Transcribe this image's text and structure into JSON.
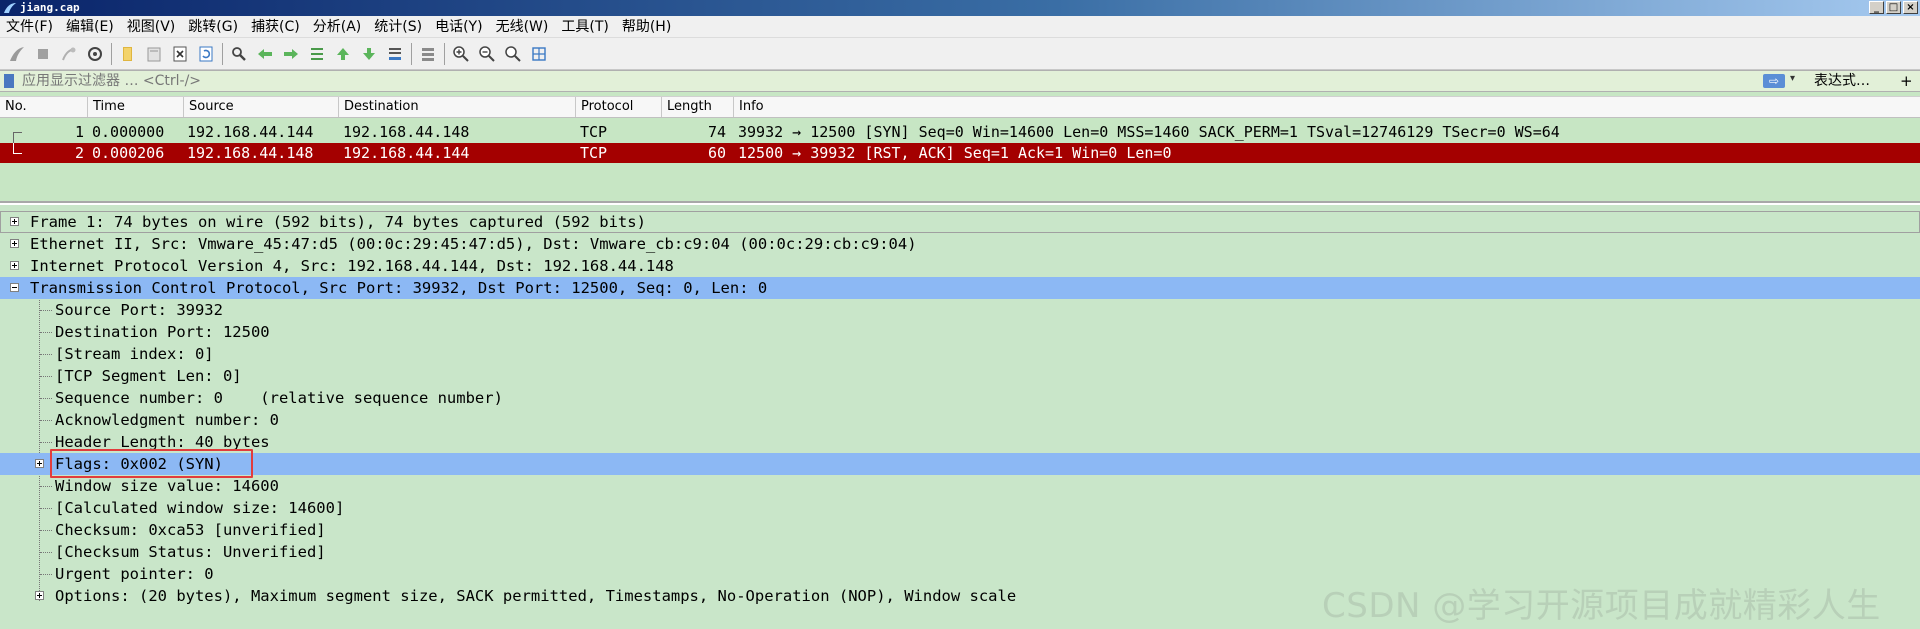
{
  "window": {
    "title": "jiang.cap",
    "controls": [
      "minimize",
      "maximize",
      "close"
    ]
  },
  "menu": [
    "文件(F)",
    "编辑(E)",
    "视图(V)",
    "跳转(G)",
    "捕获(C)",
    "分析(A)",
    "统计(S)",
    "电话(Y)",
    "无线(W)",
    "工具(T)",
    "帮助(H)"
  ],
  "toolbar_icons": [
    "shark-fin-start-icon",
    "stop-icon",
    "restart-icon",
    "capture-options-icon",
    "open-file-icon",
    "save-file-icon",
    "close-file-icon",
    "reload-icon",
    "find-packet-icon",
    "go-back-icon",
    "go-forward-icon",
    "go-to-packet-icon",
    "go-first-icon",
    "go-last-icon",
    "autoscroll-icon",
    "colorize-icon",
    "zoom-in-icon",
    "zoom-out-icon",
    "zoom-normal-icon",
    "resize-columns-icon"
  ],
  "filter": {
    "placeholder": "应用显示过滤器 … <Ctrl-/>",
    "expression_label": "表达式…",
    "add_label": "+"
  },
  "packet_list": {
    "columns": [
      "No.",
      "Time",
      "Source",
      "Destination",
      "Protocol",
      "Length",
      "Info"
    ],
    "rows": [
      {
        "no": "1",
        "time": "0.000000",
        "source": "192.168.44.144",
        "destination": "192.168.44.148",
        "protocol": "TCP",
        "length": "74",
        "info": "39932 → 12500 [SYN] Seq=0 Win=14600 Len=0 MSS=1460 SACK_PERM=1 TSval=12746129 TSecr=0 WS=64",
        "selected": false
      },
      {
        "no": "2",
        "time": "0.000206",
        "source": "192.168.44.148",
        "destination": "192.168.44.144",
        "protocol": "TCP",
        "length": "60",
        "info": "12500 → 39932 [RST, ACK] Seq=1 Ack=1 Win=0 Len=0",
        "selected": true
      }
    ]
  },
  "details": [
    {
      "text": "Frame 1: 74 bytes on wire (592 bits), 74 bytes captured (592 bits)",
      "level": 0,
      "toggle": "plus"
    },
    {
      "text": "Ethernet II, Src: Vmware_45:47:d5 (00:0c:29:45:47:d5), Dst: Vmware_cb:c9:04 (00:0c:29:cb:c9:04)",
      "level": 0,
      "toggle": "plus"
    },
    {
      "text": "Internet Protocol Version 4, Src: 192.168.44.144, Dst: 192.168.44.148",
      "level": 0,
      "toggle": "plus"
    },
    {
      "text": "Transmission Control Protocol, Src Port: 39932, Dst Port: 12500, Seq: 0, Len: 0",
      "level": 0,
      "toggle": "minus",
      "highlighted": true
    },
    {
      "text": "Source Port: 39932",
      "level": 1
    },
    {
      "text": "Destination Port: 12500",
      "level": 1
    },
    {
      "text": "[Stream index: 0]",
      "level": 1
    },
    {
      "text": "[TCP Segment Len: 0]",
      "level": 1
    },
    {
      "text": "Sequence number: 0    (relative sequence number)",
      "level": 1
    },
    {
      "text": "Acknowledgment number: 0",
      "level": 1
    },
    {
      "text": "Header Length: 40 bytes",
      "level": 1
    },
    {
      "text": "Flags: 0x002 (SYN)",
      "level": 1,
      "toggle": "plus",
      "highlighted": true
    },
    {
      "text": "Window size value: 14600",
      "level": 1
    },
    {
      "text": "[Calculated window size: 14600]",
      "level": 1
    },
    {
      "text": "Checksum: 0xca53 [unverified]",
      "level": 1
    },
    {
      "text": "[Checksum Status: Unverified]",
      "level": 1
    },
    {
      "text": "Urgent pointer: 0",
      "level": 1
    },
    {
      "text": "Options: (20 bytes), Maximum segment size, SACK permitted, Timestamps, No-Operation (NOP), Window scale",
      "level": 1,
      "toggle": "plus"
    }
  ],
  "watermark": "CSDN @学习开源项目成就精彩人生",
  "colors": {
    "selected_row": "#a40000",
    "highlight_row": "#8cb8f4",
    "pane_bg": "#c9e6c9",
    "annotation_box": "#e23c3c"
  }
}
